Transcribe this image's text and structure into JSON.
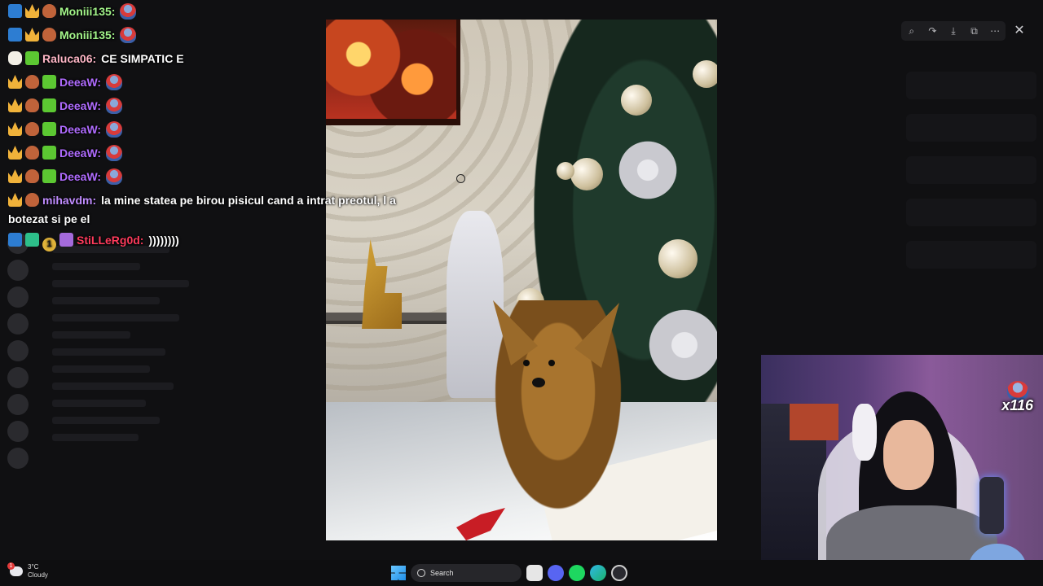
{
  "chat": {
    "messages": [
      {
        "badges": [
          "mod",
          "crown",
          "fox"
        ],
        "user": "Moniii135:",
        "user_color": "#a3f58a",
        "text": "",
        "emote": true
      },
      {
        "badges": [
          "mod",
          "crown",
          "fox"
        ],
        "user": "Moniii135:",
        "user_color": "#a3f58a",
        "text": "",
        "emote": true
      },
      {
        "badges": [
          "tea",
          "gift"
        ],
        "user": "Raluca06:",
        "user_color": "#ffb7c7",
        "text": "CE SIMPATIC E",
        "emote": false
      },
      {
        "badges": [
          "crown",
          "fox",
          "gift"
        ],
        "user": "DeeaW:",
        "user_color": "#b06cff",
        "text": "",
        "emote": true
      },
      {
        "badges": [
          "crown",
          "fox",
          "gift"
        ],
        "user": "DeeaW:",
        "user_color": "#b06cff",
        "text": "",
        "emote": true
      },
      {
        "badges": [
          "crown",
          "fox",
          "gift"
        ],
        "user": "DeeaW:",
        "user_color": "#b06cff",
        "text": "",
        "emote": true
      },
      {
        "badges": [
          "crown",
          "fox",
          "gift"
        ],
        "user": "DeeaW:",
        "user_color": "#b06cff",
        "text": "",
        "emote": true
      },
      {
        "badges": [
          "crown",
          "fox",
          "gift"
        ],
        "user": "DeeaW:",
        "user_color": "#b06cff",
        "text": "",
        "emote": true
      },
      {
        "badges": [
          "crown",
          "fox"
        ],
        "user": "mihavdm:",
        "user_color": "#c08cff",
        "text": "la mine statea pe birou pisicul cand a intrat preotul, l a botezat si pe el",
        "emote": false
      },
      {
        "badges": [
          "mod",
          "green",
          "num",
          "box"
        ],
        "user": "StiLLeRg0d:",
        "user_color": "#ff3b5c",
        "text": "))))))))",
        "emote": false
      }
    ]
  },
  "counter": {
    "text": "x116"
  },
  "weather": {
    "temp": "3°C",
    "condition": "Cloudy",
    "badge": "1"
  },
  "taskbar": {
    "search_placeholder": "Search"
  },
  "close_glyph": "✕",
  "toolbar": {
    "zoom": "⌕",
    "forward": "↷",
    "download": "⤓",
    "open": "⧉",
    "more": "⋯"
  },
  "colors": {
    "accent": "#5865f2",
    "dim_bg": "#101012"
  }
}
